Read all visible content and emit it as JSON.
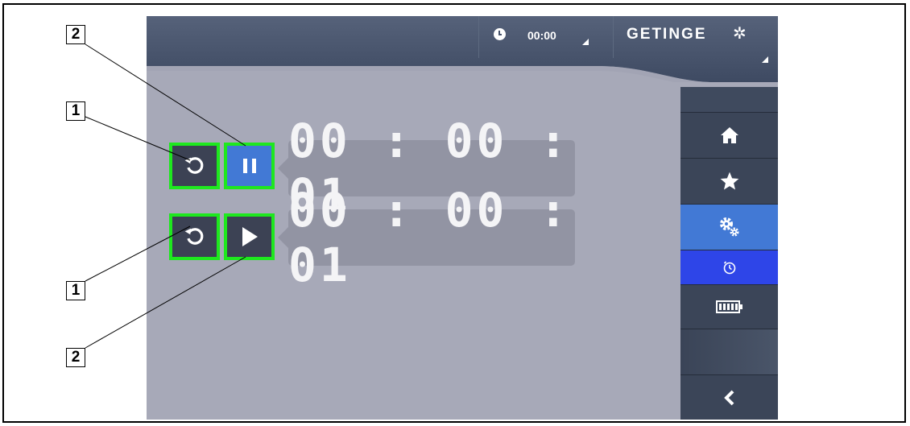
{
  "header": {
    "clock_time": "00:00",
    "logo_text": "GETINGE",
    "logo_icon": "getinge-asterisk-icon"
  },
  "sidebar": {
    "items": [
      {
        "name": "home",
        "icon": "home-icon"
      },
      {
        "name": "favorites",
        "icon": "star-icon"
      },
      {
        "name": "settings",
        "icon": "gears-icon",
        "selected": true
      },
      {
        "name": "timer",
        "icon": "stopwatch-icon",
        "selected": true
      },
      {
        "name": "battery",
        "icon": "battery-icon"
      },
      {
        "name": "back",
        "icon": "chevron-left-icon"
      }
    ]
  },
  "timers": [
    {
      "reset_icon": "reset-icon",
      "action_icon": "pause-icon",
      "value": "00 : 00 : 01"
    },
    {
      "reset_icon": "reset-icon",
      "action_icon": "play-icon",
      "value": "00 : 00 : 01"
    }
  ],
  "callouts": [
    "2",
    "1",
    "1",
    "2"
  ],
  "colors": {
    "highlight": "#1ee81e",
    "accent_blue": "#4279d5",
    "timer_blue": "#2e45e8",
    "dark_button": "#3c4254",
    "screen_bg": "#a7a9b8"
  }
}
